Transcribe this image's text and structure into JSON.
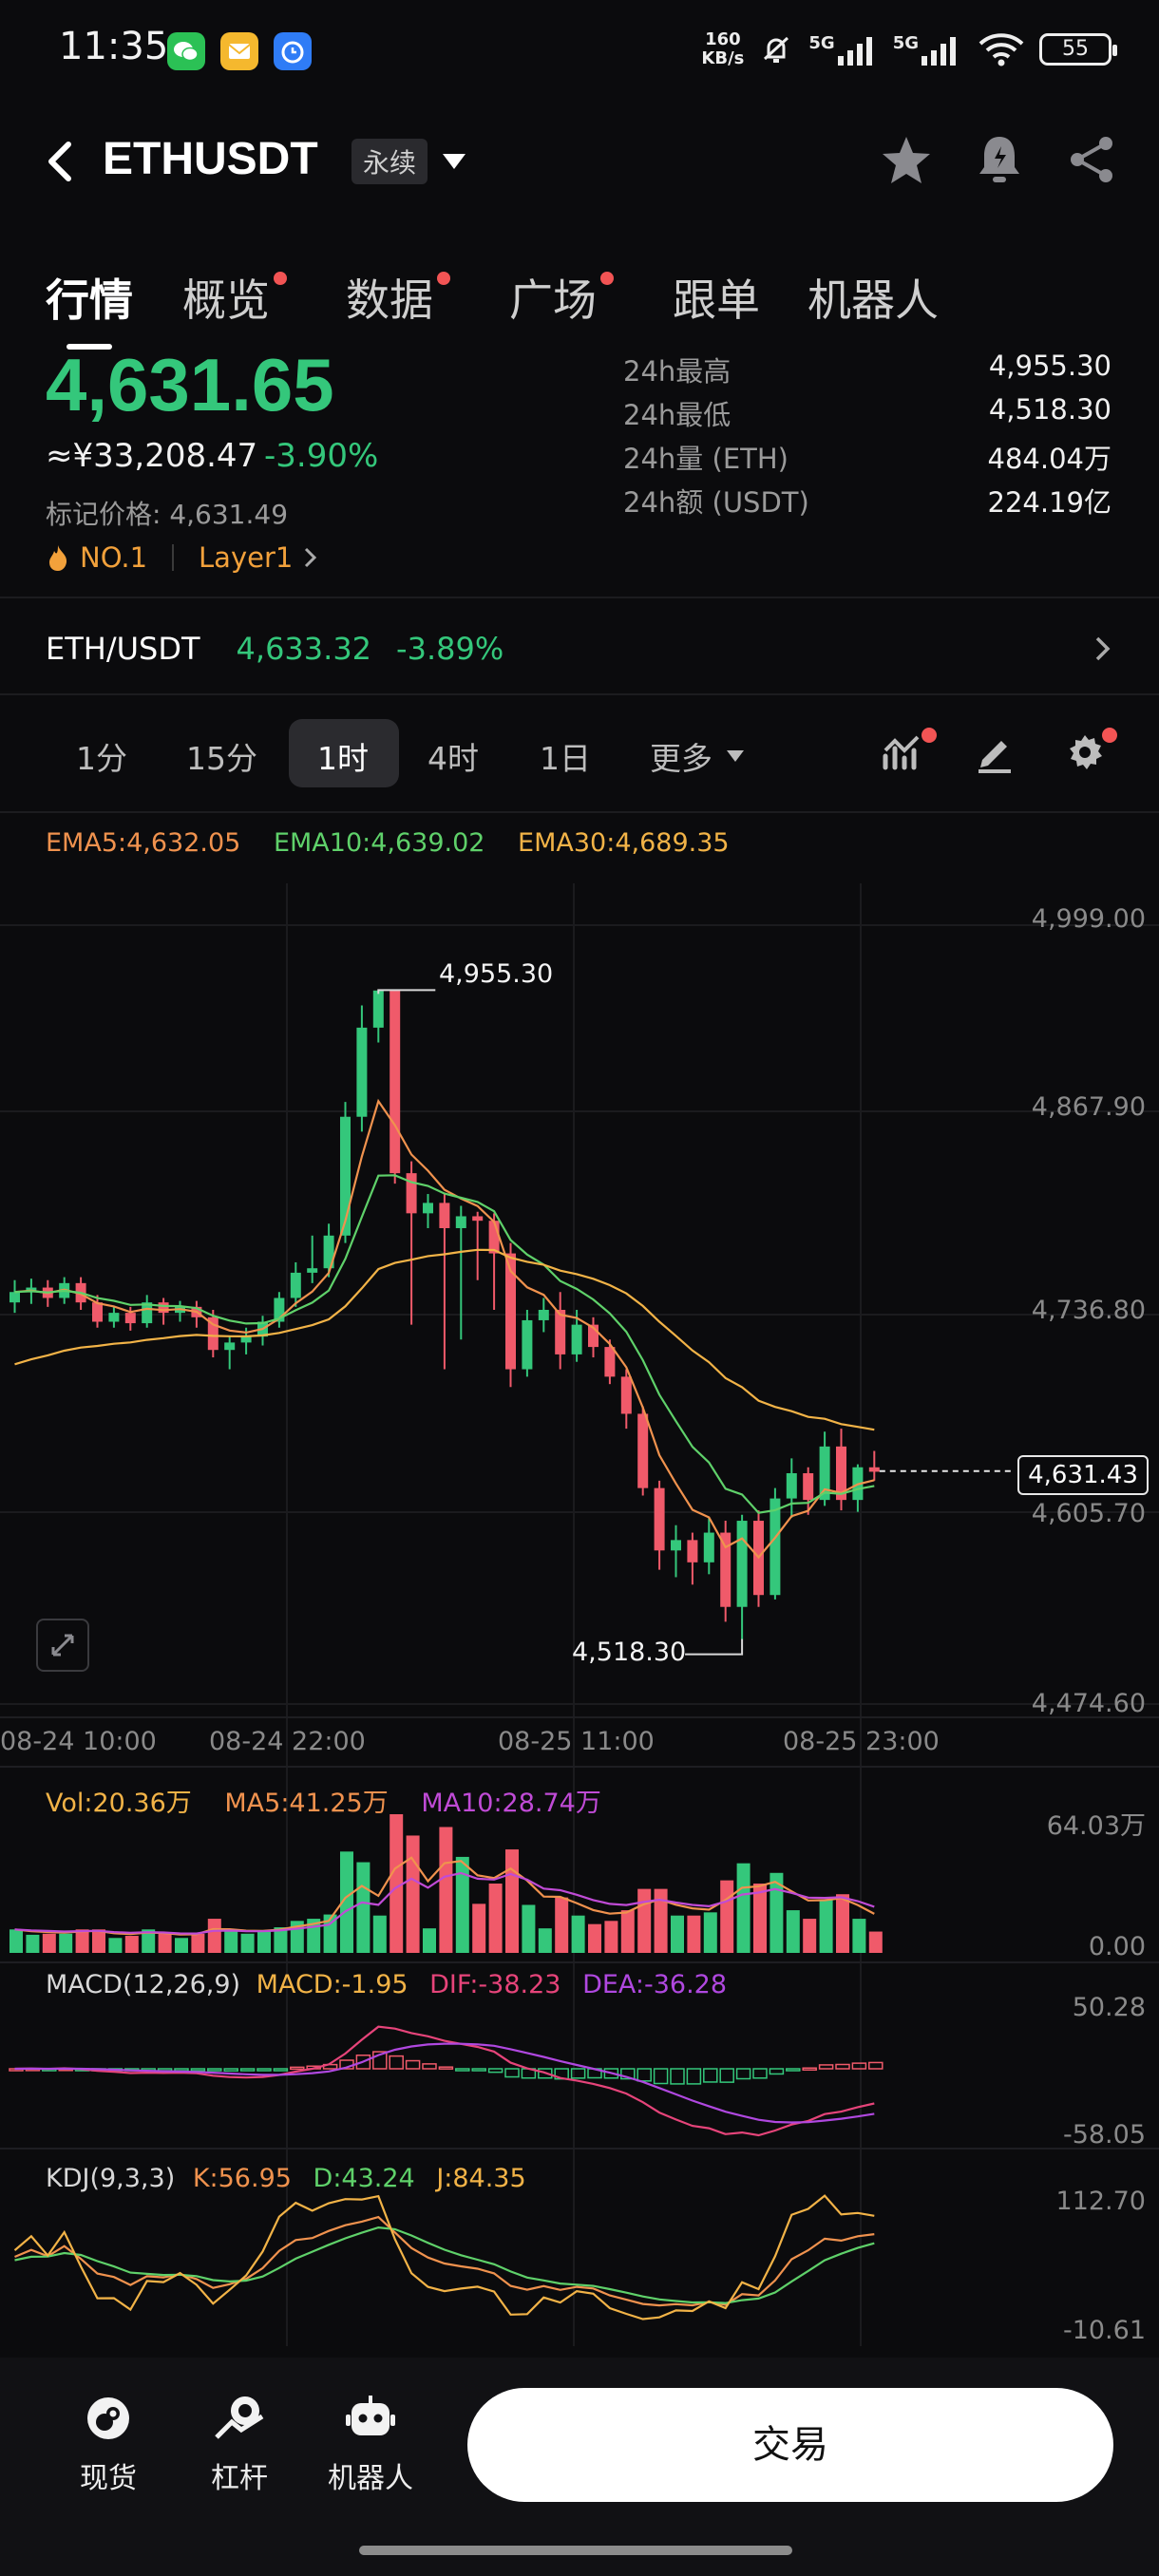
{
  "status_bar": {
    "time": "11:35",
    "net_speed_top": "160",
    "net_speed_bottom": "KB/s",
    "signal_1": "5G",
    "signal_2": "5G",
    "battery": "55"
  },
  "header": {
    "pair": "ETHUSDT",
    "contract_type": "永续",
    "icons": [
      "back-icon",
      "chevron-down-icon",
      "star-icon",
      "bell-icon",
      "share-icon"
    ]
  },
  "tabs": [
    {
      "label": "行情",
      "active": true,
      "dot": false
    },
    {
      "label": "概览",
      "active": false,
      "dot": true
    },
    {
      "label": "数据",
      "active": false,
      "dot": true
    },
    {
      "label": "广场",
      "active": false,
      "dot": true
    },
    {
      "label": "跟单",
      "active": false,
      "dot": false
    },
    {
      "label": "机器人",
      "active": false,
      "dot": false
    }
  ],
  "ticker": {
    "last_price": "4,631.65",
    "cny_price": "≈¥33,208.47",
    "change_pct": "-3.90%",
    "mark_price": "标记价格: 4,631.49",
    "rank": "NO.1",
    "tag": "Layer1",
    "stats": [
      {
        "label": "24h最高",
        "value": "4,955.30"
      },
      {
        "label": "24h最低",
        "value": "4,518.30"
      },
      {
        "label": "24h量 (ETH)",
        "value": "484.04万"
      },
      {
        "label": "24h额 (USDT)",
        "value": "224.19亿"
      }
    ]
  },
  "spot": {
    "pair": "ETH/USDT",
    "price": "4,633.32",
    "change": "-3.89%"
  },
  "intervals": {
    "items": [
      "1分",
      "15分",
      "1时",
      "4时",
      "1日",
      "更多"
    ],
    "active": "1时"
  },
  "colors": {
    "up": "#34c77b",
    "down": "#f05a6a",
    "ema5": "#f0924e",
    "ema10": "#5fd16a",
    "ema30": "#f2b347",
    "ma10": "#c04bd6",
    "dif": "#e6447a",
    "dea": "#b048e0"
  },
  "chart_data": {
    "type": "candlestick",
    "ema_text": {
      "ema5": "EMA5:4,632.05",
      "ema10": "EMA10:4,639.02",
      "ema30": "EMA30:4,689.35"
    },
    "y_ticks": [
      "4,999.00",
      "4,867.90",
      "4,736.80",
      "4,605.70",
      "4,474.60"
    ],
    "ylim": [
      4474.6,
      4999.0
    ],
    "x_ticks": [
      "08-24 10:00",
      "08-24 22:00",
      "08-25 11:00",
      "08-25 23:00"
    ],
    "high_label": "4,955.30",
    "low_label": "4,518.30",
    "current_price_tag": "4,631.43",
    "candles": [
      [
        4745,
        4752,
        4738,
        4760
      ],
      [
        4752,
        4755,
        4744,
        4761
      ],
      [
        4755,
        4748,
        4742,
        4760
      ],
      [
        4748,
        4758,
        4744,
        4762
      ],
      [
        4758,
        4745,
        4740,
        4762
      ],
      [
        4745,
        4732,
        4728,
        4750
      ],
      [
        4732,
        4738,
        4728,
        4742
      ],
      [
        4738,
        4731,
        4726,
        4742
      ],
      [
        4731,
        4745,
        4728,
        4750
      ],
      [
        4745,
        4738,
        4730,
        4748
      ],
      [
        4738,
        4742,
        4732,
        4746
      ],
      [
        4742,
        4735,
        4728,
        4746
      ],
      [
        4735,
        4713,
        4708,
        4740
      ],
      [
        4713,
        4718,
        4700,
        4722
      ],
      [
        4718,
        4722,
        4710,
        4728
      ],
      [
        4722,
        4732,
        4716,
        4736
      ],
      [
        4732,
        4748,
        4728,
        4752
      ],
      [
        4748,
        4765,
        4742,
        4772
      ],
      [
        4765,
        4768,
        4758,
        4790
      ],
      [
        4768,
        4790,
        4762,
        4798
      ],
      [
        4790,
        4870,
        4785,
        4880
      ],
      [
        4870,
        4930,
        4860,
        4945
      ],
      [
        4930,
        4955,
        4920,
        4955
      ],
      [
        4955,
        4832,
        4825,
        4955
      ],
      [
        4832,
        4805,
        4730,
        4840
      ],
      [
        4805,
        4812,
        4795,
        4818
      ],
      [
        4812,
        4795,
        4700,
        4818
      ],
      [
        4795,
        4803,
        4720,
        4810
      ],
      [
        4803,
        4800,
        4760,
        4806
      ],
      [
        4800,
        4778,
        4740,
        4805
      ],
      [
        4778,
        4700,
        4688,
        4785
      ],
      [
        4700,
        4733,
        4695,
        4740
      ],
      [
        4733,
        4740,
        4725,
        4748
      ],
      [
        4740,
        4710,
        4700,
        4752
      ],
      [
        4710,
        4730,
        4705,
        4740
      ],
      [
        4730,
        4715,
        4708,
        4735
      ],
      [
        4715,
        4695,
        4690,
        4720
      ],
      [
        4695,
        4670,
        4660,
        4700
      ],
      [
        4670,
        4620,
        4615,
        4675
      ],
      [
        4620,
        4578,
        4565,
        4625
      ],
      [
        4578,
        4585,
        4560,
        4595
      ],
      [
        4585,
        4570,
        4555,
        4590
      ],
      [
        4570,
        4590,
        4562,
        4600
      ],
      [
        4590,
        4540,
        4530,
        4598
      ],
      [
        4540,
        4598,
        4518,
        4602
      ],
      [
        4598,
        4548,
        4540,
        4605
      ],
      [
        4548,
        4613,
        4545,
        4620
      ],
      [
        4613,
        4630,
        4600,
        4640
      ],
      [
        4630,
        4612,
        4602,
        4634
      ],
      [
        4612,
        4648,
        4608,
        4658
      ],
      [
        4648,
        4612,
        4605,
        4660
      ],
      [
        4612,
        4634,
        4604,
        4636
      ],
      [
        4634,
        4631,
        4625,
        4645
      ]
    ],
    "volume": {
      "text": {
        "vol": "Vol:20.36万",
        "ma5": "MA5:41.25万",
        "ma10": "MA10:28.74万"
      },
      "y_ticks": [
        "64.03万",
        "0.00"
      ]
    },
    "macd": {
      "text": {
        "title": "MACD(12,26,9)",
        "macd": "MACD:-1.95",
        "dif": "DIF:-38.23",
        "dea": "DEA:-36.28"
      },
      "y_ticks": [
        "50.28",
        "-58.05"
      ]
    },
    "kdj": {
      "text": {
        "title": "KDJ(9,3,3)",
        "k": "K:56.95",
        "d": "D:43.24",
        "j": "J:84.35"
      },
      "y_ticks": [
        "112.70",
        "-10.61"
      ]
    }
  },
  "bottom_nav": {
    "items": [
      {
        "label": "现货",
        "icon": "spot-icon"
      },
      {
        "label": "杠杆",
        "icon": "leverage-icon"
      },
      {
        "label": "机器人",
        "icon": "robot-icon"
      }
    ],
    "trade_label": "交易"
  }
}
